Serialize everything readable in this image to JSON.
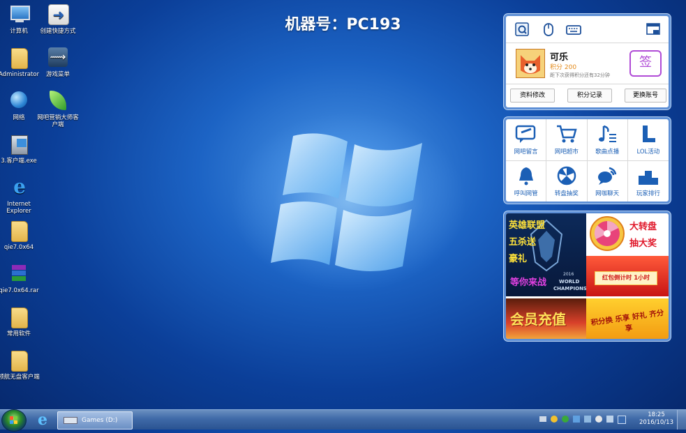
{
  "machine_title": "机器号：PC193",
  "desktop_icons": [
    {
      "label": "计算机",
      "icon": "computer-icon"
    },
    {
      "label": "创建快捷方式",
      "icon": "shortcut-icon"
    },
    {
      "label": "Administrator",
      "icon": "user-folder-icon"
    },
    {
      "label": "游戏菜单",
      "icon": "game-menu-icon"
    },
    {
      "label": "网络",
      "icon": "network-icon"
    },
    {
      "label": "网吧营销大师客户端",
      "icon": "leaf-icon"
    },
    {
      "label": "3.客户端.exe",
      "icon": "installer-icon"
    },
    {
      "label": "Internet Explorer",
      "icon": "ie-icon"
    },
    {
      "label": "qie7.0x64",
      "icon": "folder-icon"
    },
    {
      "label": "qie7.0x64.rar",
      "icon": "rar-icon"
    },
    {
      "label": "常用软件",
      "icon": "folder-icon"
    },
    {
      "label": "领航无盘客户端",
      "icon": "folder-icon"
    }
  ],
  "user_panel": {
    "name": "可乐",
    "points": "积分 200",
    "hint": "距下次获得积分还有32分钟",
    "sign_label": "签",
    "buttons": [
      "资料修改",
      "积分记录",
      "更换账号"
    ]
  },
  "service_grid": [
    {
      "label": "网吧留言",
      "icon": "message-icon"
    },
    {
      "label": "网吧超市",
      "icon": "cart-icon"
    },
    {
      "label": "歌曲点播",
      "icon": "music-icon"
    },
    {
      "label": "LOL活动",
      "icon": "lol-icon"
    },
    {
      "label": "呼叫网管",
      "icon": "bell-icon"
    },
    {
      "label": "转盘抽奖",
      "icon": "wheel-icon"
    },
    {
      "label": "网咖聊天",
      "icon": "chat-icon"
    },
    {
      "label": "玩家排行",
      "icon": "podium-icon"
    }
  ],
  "ads": {
    "lol": {
      "line1": "英雄联盟",
      "line2": "五杀送",
      "line3": "豪礼",
      "line4": "等你来战",
      "sub1": "2016",
      "sub2": "WORLD",
      "sub3": "CHAMPIONSH"
    },
    "wheel": {
      "line1": "大转盘",
      "line2": "抽大奖"
    },
    "redpack": {
      "text": "红包倒计时 1小时"
    },
    "recharge": {
      "text": "会员充值"
    },
    "points_share": {
      "text": "积分换 乐享 好礼 齐分享"
    }
  },
  "taskbar": {
    "active_window": "Games (D:)",
    "time": "18:25",
    "date": "2016/10/13"
  },
  "colors": {
    "panel_border": "#5d8fd6",
    "link_blue": "#1b5fb5",
    "points_orange": "#e38a1a",
    "sign_purple": "#b04bd6"
  }
}
